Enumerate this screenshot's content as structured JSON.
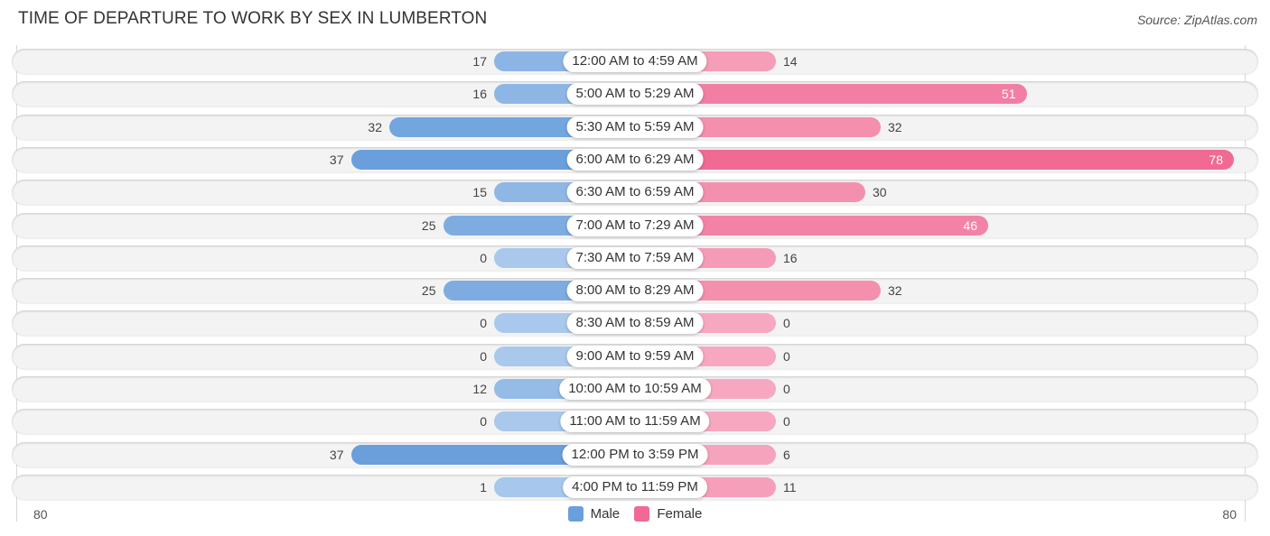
{
  "header": {
    "title": "TIME OF DEPARTURE TO WORK BY SEX IN LUMBERTON",
    "source": "Source: ZipAtlas.com"
  },
  "colors": {
    "male": "#6a9fdc",
    "male_light": "#a9c8ec",
    "female": "#f06a94",
    "female_light": "#f7a8c0"
  },
  "chart_data": {
    "type": "bar",
    "orientation": "horizontal-diverging",
    "title": "TIME OF DEPARTURE TO WORK BY SEX IN LUMBERTON",
    "categories": [
      "12:00 AM to 4:59 AM",
      "5:00 AM to 5:29 AM",
      "5:30 AM to 5:59 AM",
      "6:00 AM to 6:29 AM",
      "6:30 AM to 6:59 AM",
      "7:00 AM to 7:29 AM",
      "7:30 AM to 7:59 AM",
      "8:00 AM to 8:29 AM",
      "8:30 AM to 8:59 AM",
      "9:00 AM to 9:59 AM",
      "10:00 AM to 10:59 AM",
      "11:00 AM to 11:59 AM",
      "12:00 PM to 3:59 PM",
      "4:00 PM to 11:59 PM"
    ],
    "series": [
      {
        "name": "Male",
        "values": [
          17,
          16,
          32,
          37,
          15,
          25,
          0,
          25,
          0,
          0,
          12,
          0,
          37,
          1
        ]
      },
      {
        "name": "Female",
        "values": [
          14,
          51,
          32,
          78,
          30,
          46,
          16,
          32,
          0,
          0,
          0,
          0,
          6,
          11
        ]
      }
    ],
    "xlim": [
      -80,
      80
    ],
    "axis_ticks": {
      "left": "80",
      "right": "80"
    },
    "legend": {
      "position": "bottom-center",
      "entries": [
        "Male",
        "Female"
      ]
    },
    "grid": false
  }
}
